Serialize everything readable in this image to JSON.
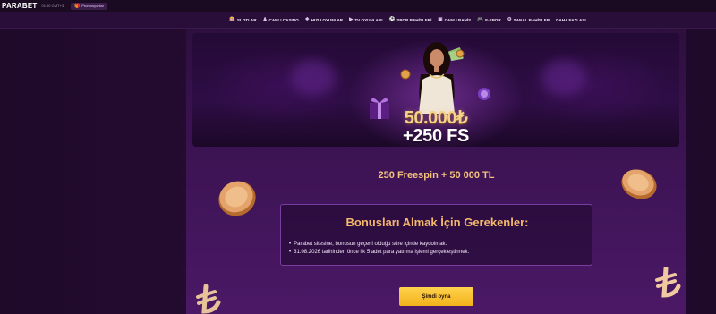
{
  "topbar": {
    "logo": "PARABET",
    "clock": "01:00 GMT+3",
    "promo_label": "Promosyonlar"
  },
  "nav": {
    "items": [
      {
        "icon": "slots-icon",
        "label": "SLOTLAR"
      },
      {
        "icon": "live-casino-icon",
        "label": "CANLI CASINO"
      },
      {
        "icon": "fast-games-icon",
        "label": "HIZLI OYUNLAR"
      },
      {
        "icon": "tv-games-icon",
        "label": "TV OYUNLARI"
      },
      {
        "icon": "sports-betting-icon",
        "label": "SPOR BAHİSLERİ"
      },
      {
        "icon": "live-betting-icon",
        "label": "CANLI BAHİS"
      },
      {
        "icon": "esports-icon",
        "label": "E-SPOR"
      },
      {
        "icon": "virtual-betting-icon",
        "label": "SANAL BAHİSLER"
      },
      {
        "icon": "",
        "label": "DAHA FAZLASI"
      }
    ]
  },
  "banner": {
    "amount": "50.000₺",
    "freespins": "+250 FS"
  },
  "headline": "250 Freespin + 50 000 TL",
  "requirements": {
    "title": "Bonusları Almak İçin Gerekenler:",
    "items": [
      "Parabet sitesine, bonusun geçerli olduğu süre içinde kaydolmak.",
      "31.08.2026 tarihinden önce ilk 5 adet para yatırma işlemi gerçekleştirmek."
    ]
  },
  "cta_label": "Şimdi oyna",
  "colors": {
    "background": "#1e0a2a",
    "panel": "#3a1250",
    "accent_gold": "#f3c27c",
    "cta": "#f2b21c",
    "box_border": "#7a3ea0"
  }
}
